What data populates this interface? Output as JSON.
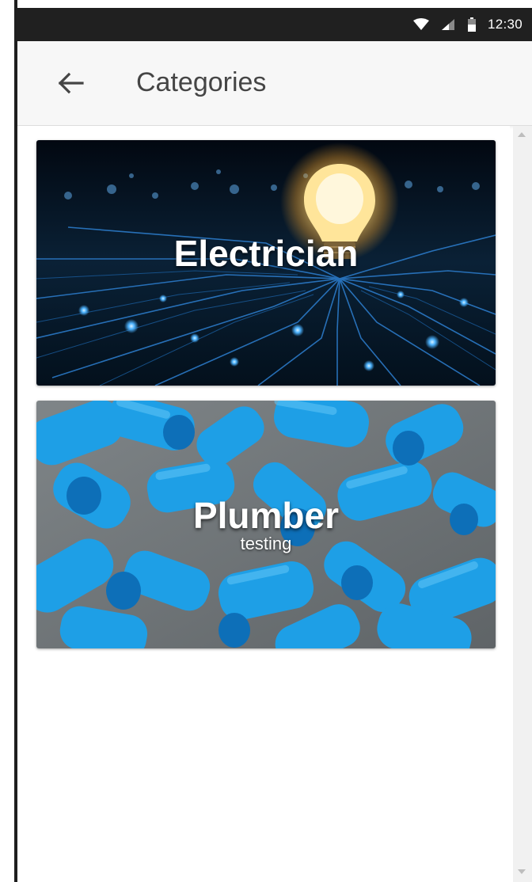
{
  "status_bar": {
    "time": "12:30",
    "icons": [
      "wifi-icon",
      "signal-icon",
      "battery-icon"
    ]
  },
  "app_bar": {
    "back_icon": "arrow-back-icon",
    "title": "Categories"
  },
  "categories": [
    {
      "title": "Electrician",
      "subtitle": "",
      "image": "circuit-bulb"
    },
    {
      "title": "Plumber",
      "subtitle": "testing",
      "image": "blue-pipes"
    }
  ],
  "colors": {
    "status_bar": "#202020",
    "app_bar": "#f7f7f7",
    "title_text": "#454545",
    "pipe_blue": "#1ea0e6"
  }
}
